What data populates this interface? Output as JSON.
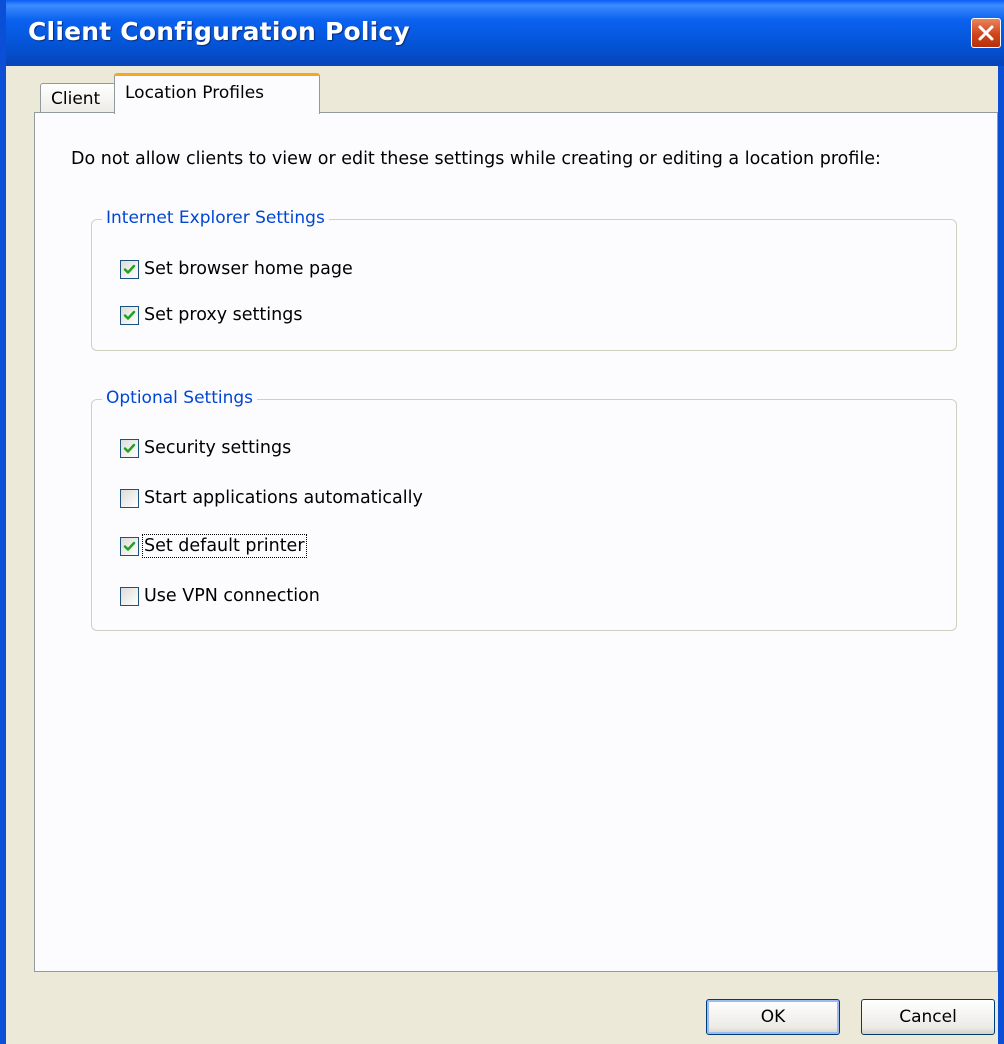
{
  "window": {
    "title": "Client Configuration Policy"
  },
  "tabs": [
    {
      "label": "Client",
      "active": false
    },
    {
      "label": "Location Profiles",
      "active": true
    }
  ],
  "panel": {
    "instruction": "Do not allow clients to view or edit these settings while creating or editing a location profile:"
  },
  "groups": [
    {
      "title": "Internet Explorer Settings",
      "items": [
        {
          "label": "Set browser home page",
          "checked": true
        },
        {
          "label": "Set proxy settings",
          "checked": true
        }
      ]
    },
    {
      "title": "Optional Settings",
      "items": [
        {
          "label": "Security settings",
          "checked": true
        },
        {
          "label": "Start applications automatically",
          "checked": false
        },
        {
          "label": "Set default printer",
          "checked": true,
          "focused": true
        },
        {
          "label": "Use VPN connection",
          "checked": false
        }
      ]
    }
  ],
  "buttons": {
    "ok": "OK",
    "cancel": "Cancel"
  },
  "colors": {
    "titlebar": "#0453d4",
    "group_title": "#0046d5",
    "check": "#21a121",
    "tab_highlight": "#f5a623"
  }
}
